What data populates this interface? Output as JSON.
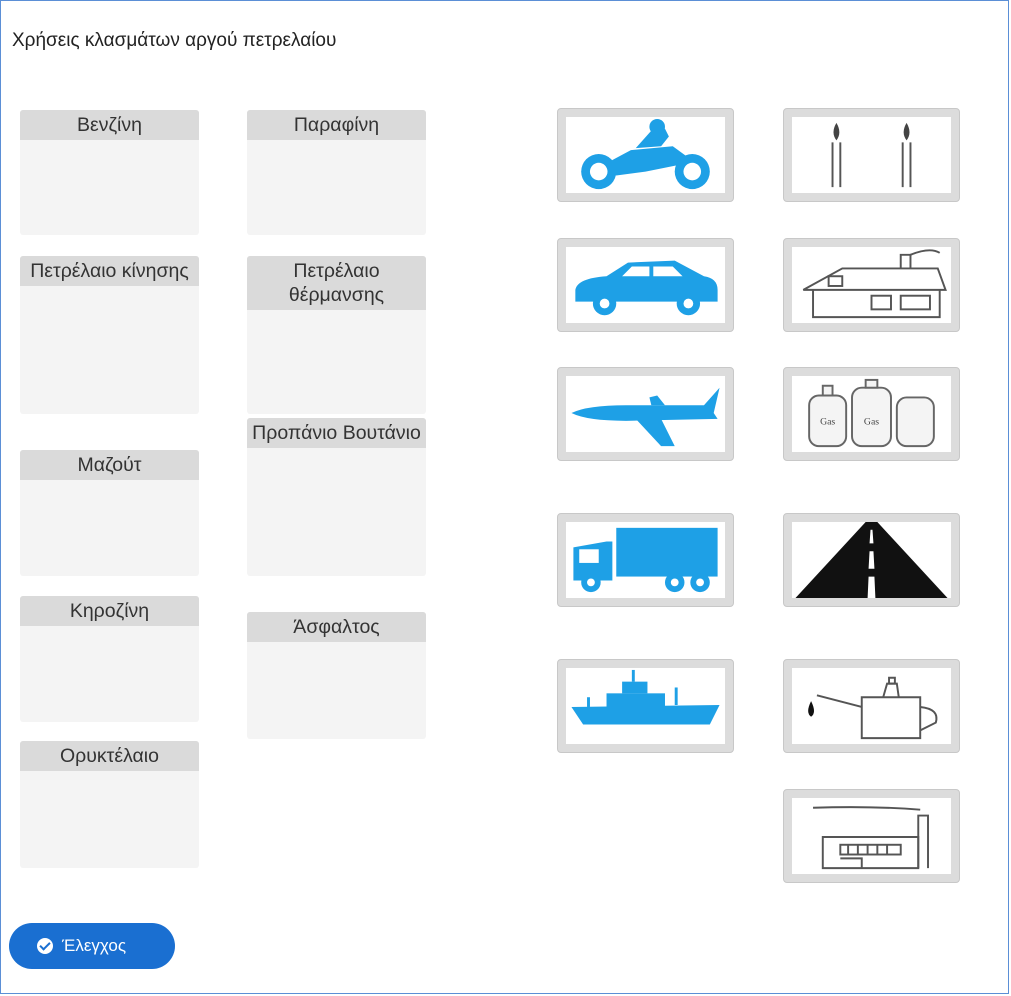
{
  "title": "Χρήσεις κλασμάτων αργού πετρελαίου",
  "zones": [
    {
      "label": "Βενζίνη"
    },
    {
      "label": "Πετρέλαιο κίνησης"
    },
    {
      "label": "Μαζούτ"
    },
    {
      "label": "Κηροζίνη"
    },
    {
      "label": "Ορυκτέλαιο"
    },
    {
      "label": "Παραφίνη"
    },
    {
      "label": "Πετρέλαιο θέρμανσης"
    },
    {
      "label": "Προπάνιο Βουτάνιο"
    },
    {
      "label": "Άσφαλτος"
    }
  ],
  "cards": [
    {
      "icon": "motorcycle-icon"
    },
    {
      "icon": "candles-icon"
    },
    {
      "icon": "car-icon"
    },
    {
      "icon": "house-icon"
    },
    {
      "icon": "airplane-icon"
    },
    {
      "icon": "gas-cylinders-icon",
      "text": "Gas"
    },
    {
      "icon": "truck-icon"
    },
    {
      "icon": "road-icon"
    },
    {
      "icon": "ship-icon"
    },
    {
      "icon": "oil-can-icon"
    },
    {
      "icon": "factory-icon"
    }
  ],
  "check_button": {
    "label": "Έλεγχος"
  },
  "colors": {
    "accent": "#1a6fd1",
    "icon_blue": "#1ea0e6",
    "frame": "#5b8fd6"
  }
}
